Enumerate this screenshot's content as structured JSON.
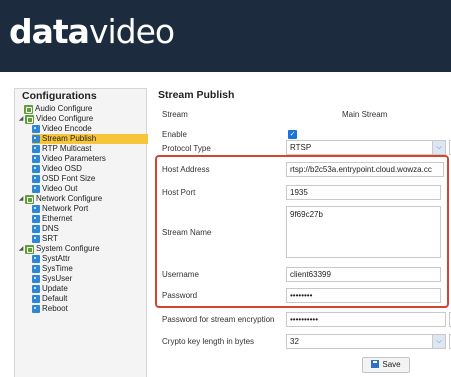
{
  "brand": {
    "logo_bold": "data",
    "logo_light": "video"
  },
  "sidebar": {
    "title": "Configurations",
    "items": [
      {
        "label": "Audio Configure",
        "level": 1,
        "kind": "category"
      },
      {
        "label": "Video Configure",
        "level": 1,
        "kind": "category",
        "expanded": true
      },
      {
        "label": "Video Encode",
        "level": 2,
        "kind": "leaf"
      },
      {
        "label": "Stream Publish",
        "level": 2,
        "kind": "leaf",
        "selected": true
      },
      {
        "label": "RTP Multicast",
        "level": 2,
        "kind": "leaf"
      },
      {
        "label": "Video Parameters",
        "level": 2,
        "kind": "leaf"
      },
      {
        "label": "Video OSD",
        "level": 2,
        "kind": "leaf"
      },
      {
        "label": "OSD Font Size",
        "level": 2,
        "kind": "leaf"
      },
      {
        "label": "Video Out",
        "level": 2,
        "kind": "leaf"
      },
      {
        "label": "Network Configure",
        "level": 1,
        "kind": "category",
        "expanded": true
      },
      {
        "label": "Network Port",
        "level": 2,
        "kind": "leaf"
      },
      {
        "label": "Ethernet",
        "level": 2,
        "kind": "leaf"
      },
      {
        "label": "DNS",
        "level": 2,
        "kind": "leaf"
      },
      {
        "label": "SRT",
        "level": 2,
        "kind": "leaf"
      },
      {
        "label": "System Configure",
        "level": 1,
        "kind": "category",
        "expanded": true
      },
      {
        "label": "SystAttr",
        "level": 2,
        "kind": "leaf"
      },
      {
        "label": "SysTime",
        "level": 2,
        "kind": "leaf"
      },
      {
        "label": "SysUser",
        "level": 2,
        "kind": "leaf"
      },
      {
        "label": "Update",
        "level": 2,
        "kind": "leaf"
      },
      {
        "label": "Default",
        "level": 2,
        "kind": "leaf"
      },
      {
        "label": "Reboot",
        "level": 2,
        "kind": "leaf"
      }
    ]
  },
  "panel": {
    "title": "Stream Publish",
    "stream": {
      "label": "Stream",
      "value": "Main Stream"
    },
    "enable": {
      "label": "Enable",
      "checked": true
    },
    "protocol": {
      "label": "Protocol Type",
      "value": "RTSP"
    },
    "host_address": {
      "label": "Host Address",
      "value": "rtsp://b2c53a.entrypoint.cloud.wowza.cc"
    },
    "host_port": {
      "label": "Host Port",
      "value": "1935"
    },
    "stream_name": {
      "label": "Stream Name",
      "value": "9f69c27b"
    },
    "username": {
      "label": "Username",
      "value": "client63399"
    },
    "password": {
      "label": "Password",
      "value": "••••••••"
    },
    "enc_password": {
      "label": "Password for stream encryption",
      "value": "••••••••••"
    },
    "crypto_key": {
      "label": "Crypto key length in bytes",
      "value": "32"
    },
    "save_label": "Save"
  },
  "colors": {
    "header_bg": "#1c2c3e",
    "highlight": "#d5452e",
    "selected_bg": "#f7c53a",
    "checkbox": "#1b72d9"
  }
}
